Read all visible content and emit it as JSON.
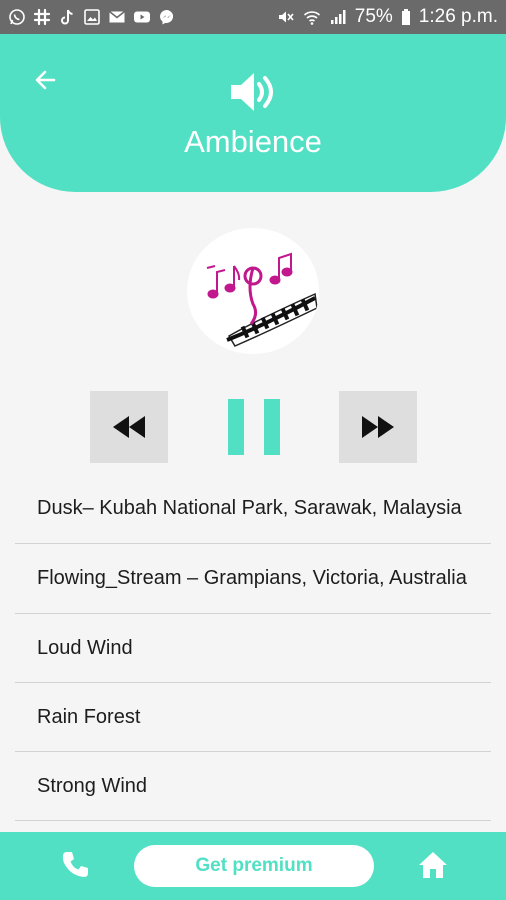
{
  "status_bar": {
    "battery": "75%",
    "time": "1:26 p.m.",
    "left_icons": [
      "whatsapp-icon",
      "slack-icon",
      "tiktok-icon",
      "gallery-icon",
      "mail-icon",
      "youtube-icon",
      "messenger-icon"
    ],
    "right_icons": [
      "mute-icon",
      "wifi-icon",
      "signal-icon",
      "battery-icon"
    ]
  },
  "header": {
    "title": "Ambience",
    "back_icon": "arrow-left-icon",
    "speaker_icon": "speaker-icon"
  },
  "player": {
    "rewind_icon": "rewind-icon",
    "pause_icon": "pause-icon",
    "forward_icon": "fast-forward-icon"
  },
  "tracks": [
    {
      "title": "Dusk– Kubah National Park, Sarawak, Malaysia"
    },
    {
      "title": "Flowing_Stream – Grampians, Victoria, Australia"
    },
    {
      "title": "Loud Wind"
    },
    {
      "title": "Rain Forest"
    },
    {
      "title": "Strong Wind"
    }
  ],
  "bottom_bar": {
    "premium_label": "Get premium",
    "phone_icon": "phone-icon",
    "home_icon": "home-icon"
  },
  "colors": {
    "accent": "#52e0c4",
    "status_bar": "#6a6a6a",
    "button_gray": "#dedede",
    "text": "#1d1d1d"
  }
}
